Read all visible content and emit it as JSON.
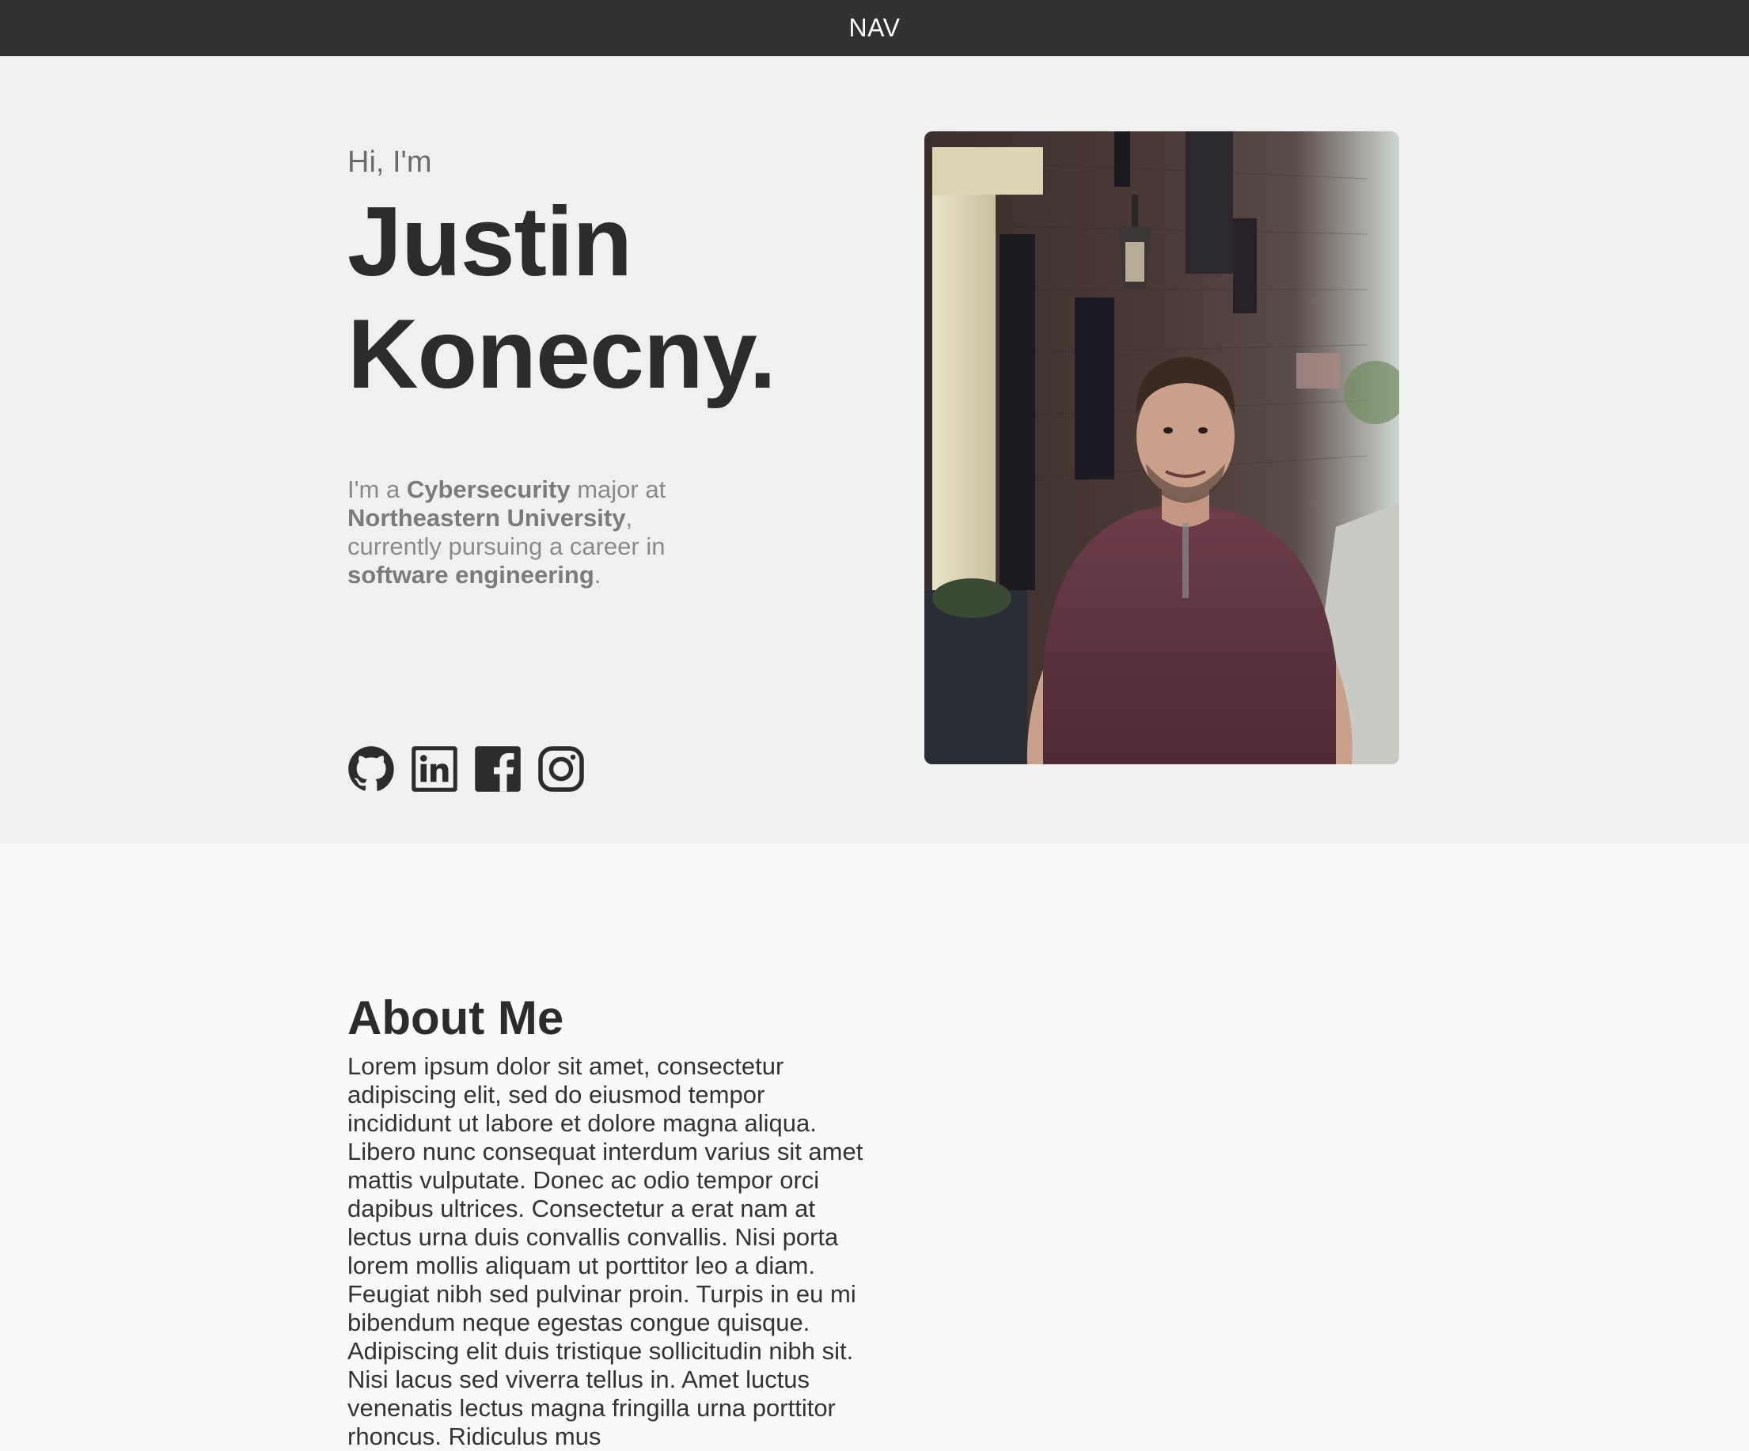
{
  "nav": {
    "label": "NAV"
  },
  "hero": {
    "greeting": "Hi, I'm",
    "first_name": "Justin",
    "last_name": "Konecny.",
    "tagline": {
      "t1": "I'm a ",
      "b1": "Cybersecurity",
      "t2": " major at ",
      "b2": "Northeastern University",
      "t3": ", currently pursuing a career in ",
      "b3": "software engineering",
      "t4": "."
    },
    "socials": [
      {
        "name": "GitHub",
        "icon": "github-icon"
      },
      {
        "name": "LinkedIn",
        "icon": "linkedin-icon"
      },
      {
        "name": "Facebook",
        "icon": "facebook-icon"
      },
      {
        "name": "Instagram",
        "icon": "instagram-icon"
      }
    ],
    "photo_alt": "Justin Konecny"
  },
  "about": {
    "heading": "About Me",
    "text": "Lorem ipsum dolor sit amet, consectetur adipiscing elit, sed do eiusmod tempor incididunt ut labore et dolore magna aliqua. Libero nunc consequat interdum varius sit amet mattis vulputate. Donec ac odio tempor orci dapibus ultrices. Consectetur a erat nam at lectus urna duis convallis convallis. Nisi porta lorem mollis aliquam ut porttitor leo a diam. Feugiat nibh sed pulvinar proin. Turpis in eu mi bibendum neque egestas congue quisque. Adipiscing elit duis tristique sollicitudin nibh sit. Nisi lacus sed viverra tellus in. Amet luctus venenatis lectus magna fringilla urna porttitor rhoncus. Ridiculus mus"
  },
  "colors": {
    "nav_bg": "#313131",
    "hero_bg": "#f0f0f0",
    "page_bg": "#fafafa",
    "heading_text": "#2c2c2c",
    "muted_text": "#8a8a8a"
  }
}
